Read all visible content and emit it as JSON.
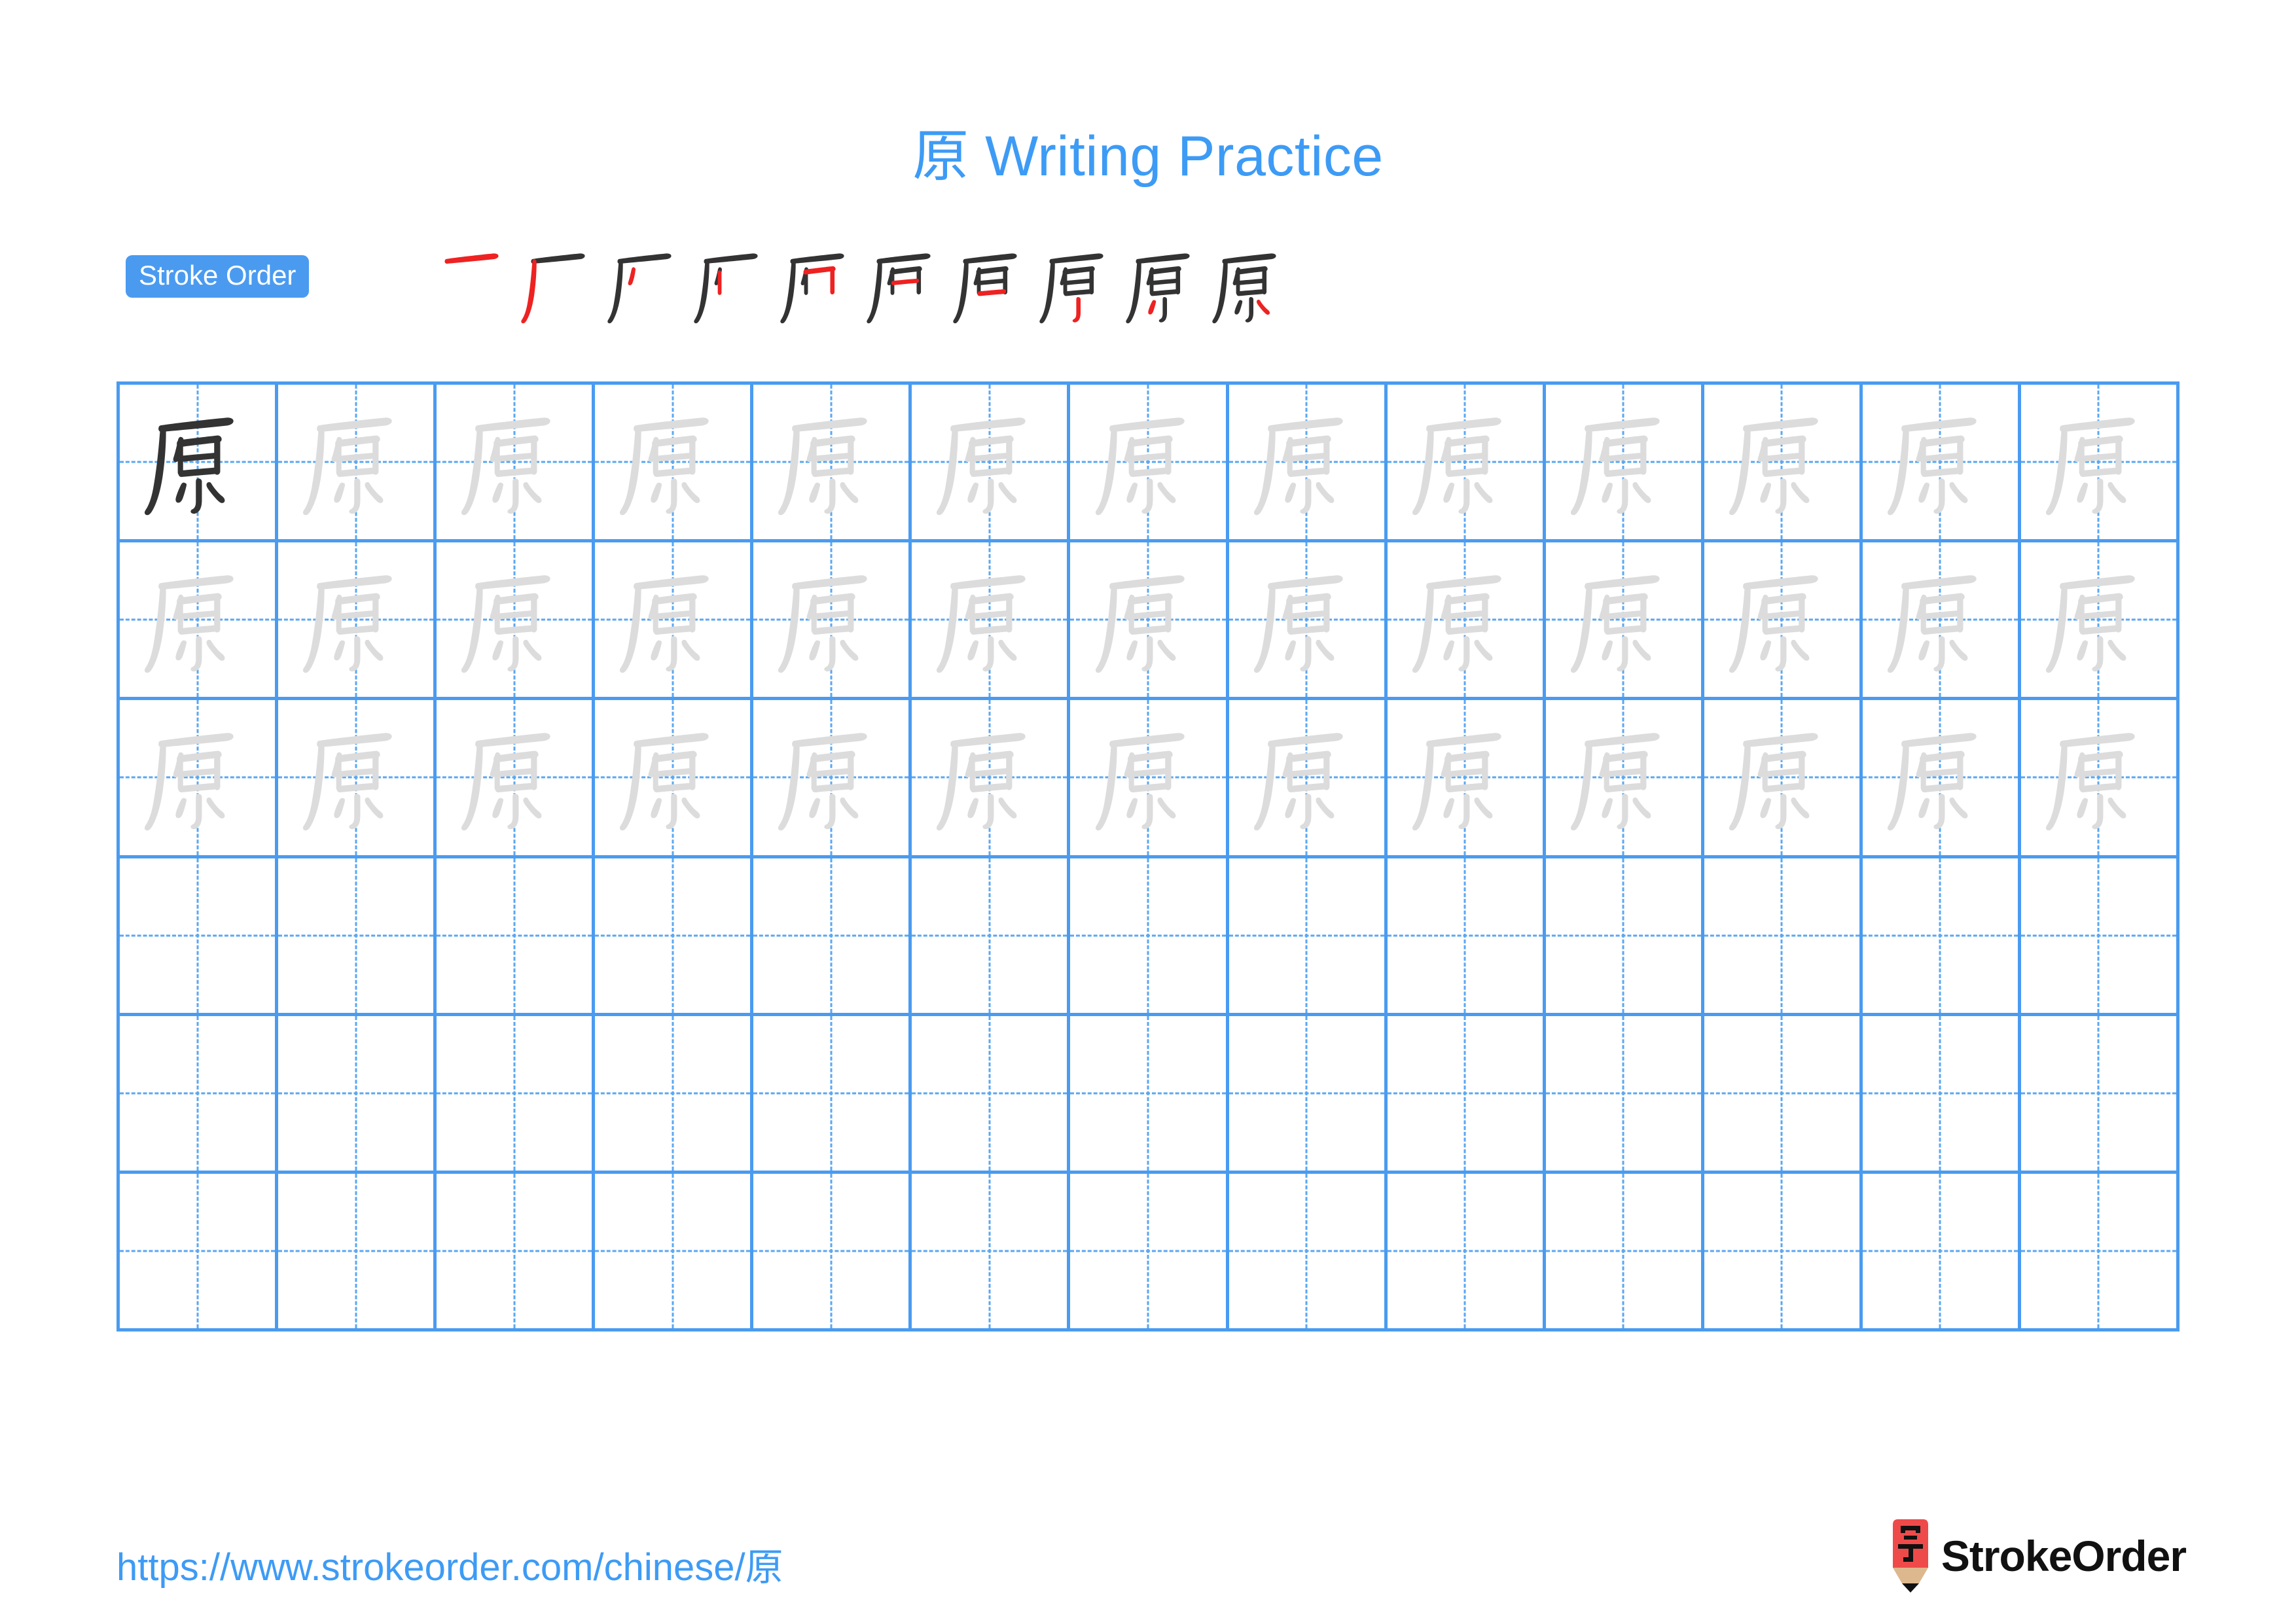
{
  "page": {
    "character": "原",
    "title_prefix": "原",
    "title_text": "Writing Practice",
    "background": "#ffffff"
  },
  "colors": {
    "title_blue": "#3d9bf5",
    "badge_blue": "#4a9bf0",
    "grid_blue": "#4a9bf0",
    "grid_dash_blue": "#5aa7f2",
    "glyph_dark": "#333333",
    "glyph_light": "#dcdcdc",
    "stroke_highlight_red": "#ee2222",
    "stroke_base_dark": "#333333",
    "logo_red": "#ef4a4a",
    "logo_wood": "#ddb88e"
  },
  "stroke_order": {
    "badge_label": "Stroke Order",
    "stroke_count": 10,
    "steps": [
      {
        "index": 1,
        "partial": "一"
      },
      {
        "index": 2,
        "partial": "厂"
      },
      {
        "index": 3,
        "partial": "厂"
      },
      {
        "index": 4,
        "partial": "尸"
      },
      {
        "index": 5,
        "partial": "厑"
      },
      {
        "index": 6,
        "partial": "厇"
      },
      {
        "index": 7,
        "partial": "厈"
      },
      {
        "index": 8,
        "partial": "厡"
      },
      {
        "index": 9,
        "partial": "原"
      },
      {
        "index": 10,
        "partial": "原"
      }
    ]
  },
  "practice_grid": {
    "columns": 13,
    "rows": 6,
    "traced_rows": 3,
    "blank_rows": 3,
    "cells": [
      [
        "dark",
        "light",
        "light",
        "light",
        "light",
        "light",
        "light",
        "light",
        "light",
        "light",
        "light",
        "light",
        "light"
      ],
      [
        "light",
        "light",
        "light",
        "light",
        "light",
        "light",
        "light",
        "light",
        "light",
        "light",
        "light",
        "light",
        "light"
      ],
      [
        "light",
        "light",
        "light",
        "light",
        "light",
        "light",
        "light",
        "light",
        "light",
        "light",
        "light",
        "light",
        "light"
      ],
      [
        "empty",
        "empty",
        "empty",
        "empty",
        "empty",
        "empty",
        "empty",
        "empty",
        "empty",
        "empty",
        "empty",
        "empty",
        "empty"
      ],
      [
        "empty",
        "empty",
        "empty",
        "empty",
        "empty",
        "empty",
        "empty",
        "empty",
        "empty",
        "empty",
        "empty",
        "empty",
        "empty"
      ],
      [
        "empty",
        "empty",
        "empty",
        "empty",
        "empty",
        "empty",
        "empty",
        "empty",
        "empty",
        "empty",
        "empty",
        "empty",
        "empty"
      ]
    ]
  },
  "footer": {
    "url": "https://www.strokeorder.com/chinese/原",
    "brand_name": "StrokeOrder",
    "logo_character": "字"
  }
}
